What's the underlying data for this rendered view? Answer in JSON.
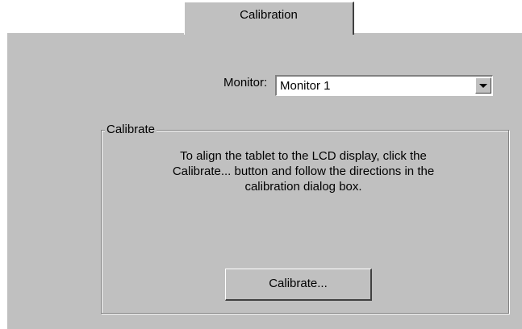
{
  "tabs": [
    {
      "label": "Calibration"
    }
  ],
  "monitor": {
    "label": "Monitor:",
    "selected": "Monitor 1"
  },
  "calibrate_group": {
    "title": "Calibrate",
    "instructions": "To align the tablet to the LCD display, click the Calibrate... button and follow the directions in the calibration dialog box.",
    "button_label": "Calibrate..."
  },
  "icons": {
    "dropdown": "chevron-down-icon"
  }
}
